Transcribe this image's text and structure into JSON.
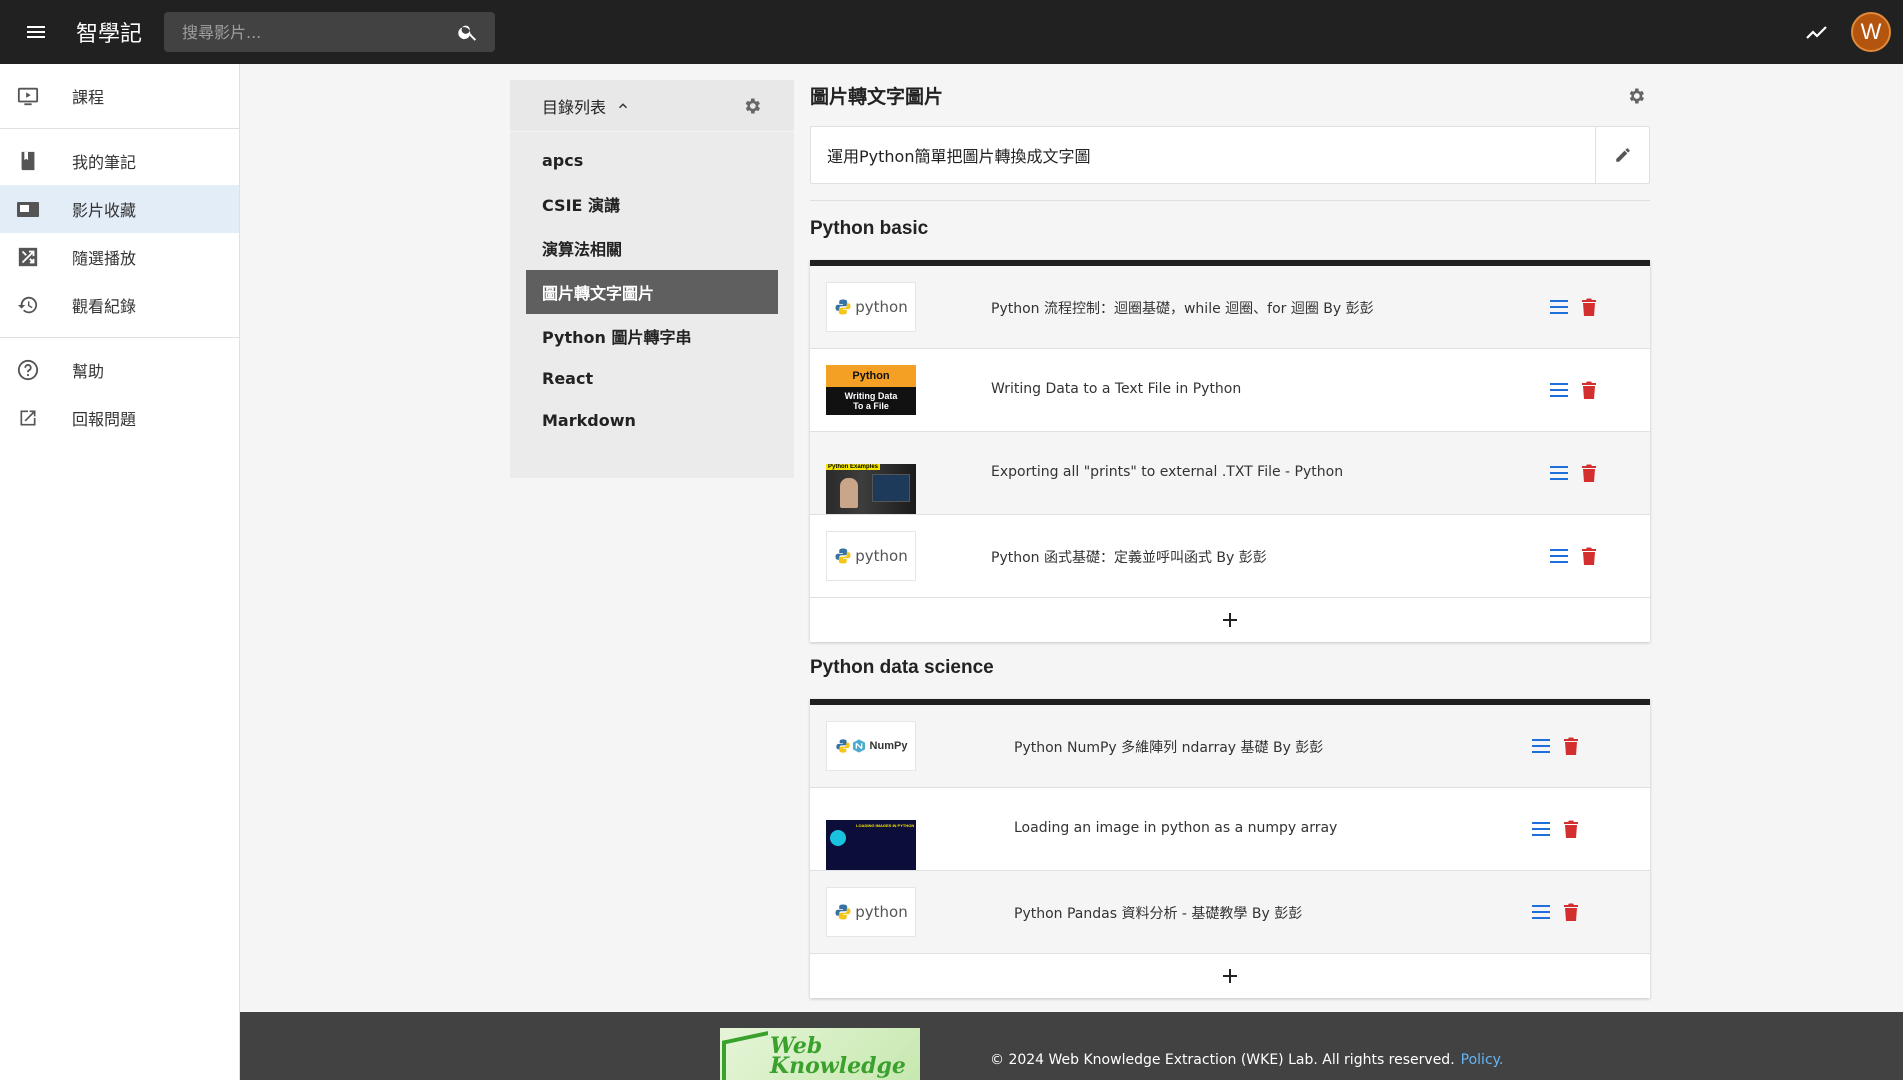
{
  "app": {
    "title": "智學記"
  },
  "search": {
    "placeholder": "搜尋影片..."
  },
  "user": {
    "avatar_letter": "W",
    "avatar_color": "#b3540f"
  },
  "sidebar": {
    "items": [
      {
        "label": "課程",
        "icon": "play-screen-icon"
      },
      {
        "label": "我的筆記",
        "icon": "book-icon"
      },
      {
        "label": "影片收藏",
        "icon": "video-library-icon",
        "active": true
      },
      {
        "label": "隨選播放",
        "icon": "shuffle-icon"
      },
      {
        "label": "觀看紀錄",
        "icon": "history-icon"
      },
      {
        "label": "幫助",
        "icon": "help-icon"
      },
      {
        "label": "回報問題",
        "icon": "external-link-icon"
      }
    ]
  },
  "categories": {
    "header": "目錄列表",
    "items": [
      "apcs",
      "CSIE 演講",
      "演算法相關",
      "圖片轉文字圖片",
      "Python 圖片轉字串",
      "React",
      "Markdown"
    ],
    "selected": "圖片轉文字圖片"
  },
  "main": {
    "title": "圖片轉文字圖片",
    "description": "運用Python簡單把圖片轉換成文字圖"
  },
  "groups": [
    {
      "title": "Python basic",
      "videos": [
        {
          "title": "Python 流程控制：迴圈基礎，while 迴圈、for 迴圈 By 彭彭",
          "thumb": "python-logo"
        },
        {
          "title": "Writing Data to a Text File in Python",
          "thumb": "orange-python",
          "thumb_top": "Python",
          "thumb_bottom": [
            "Writing Data",
            "To a File"
          ]
        },
        {
          "title": "Exporting all \"prints\" to external .TXT File - Python",
          "thumb": "python-examples",
          "thumb_label": "Python Examples"
        },
        {
          "title": "Python 函式基礎：定義並呼叫函式 By 彭彭",
          "thumb": "python-logo"
        }
      ]
    },
    {
      "title": "Python data science",
      "videos": [
        {
          "title": "Python NumPy 多維陣列 ndarray 基礎 By 彭彭",
          "thumb": "numpy-logo",
          "thumb_word": "NumPy"
        },
        {
          "title": "Loading an image in python as a numpy array",
          "thumb": "dark-loading",
          "thumb_label": "LOADING IMAGES IN PYTHON"
        },
        {
          "title": "Python Pandas 資料分析 - 基礎教學 By 彭彭",
          "thumb": "python-logo"
        }
      ]
    }
  ],
  "thumb_text": {
    "python_word": "python"
  },
  "footer": {
    "logo_words": [
      "Web",
      "Knowledge"
    ],
    "copyright": "© 2024 Web Knowledge Extraction (WKE) Lab. All rights reserved.",
    "policy_link": "Policy."
  },
  "colors": {
    "appbar": "#212121",
    "list_icon": "#1e6fd9",
    "delete_icon": "#d32f2f",
    "active_nav": "#e3edf7",
    "selected_category": "#5f5f5f"
  }
}
